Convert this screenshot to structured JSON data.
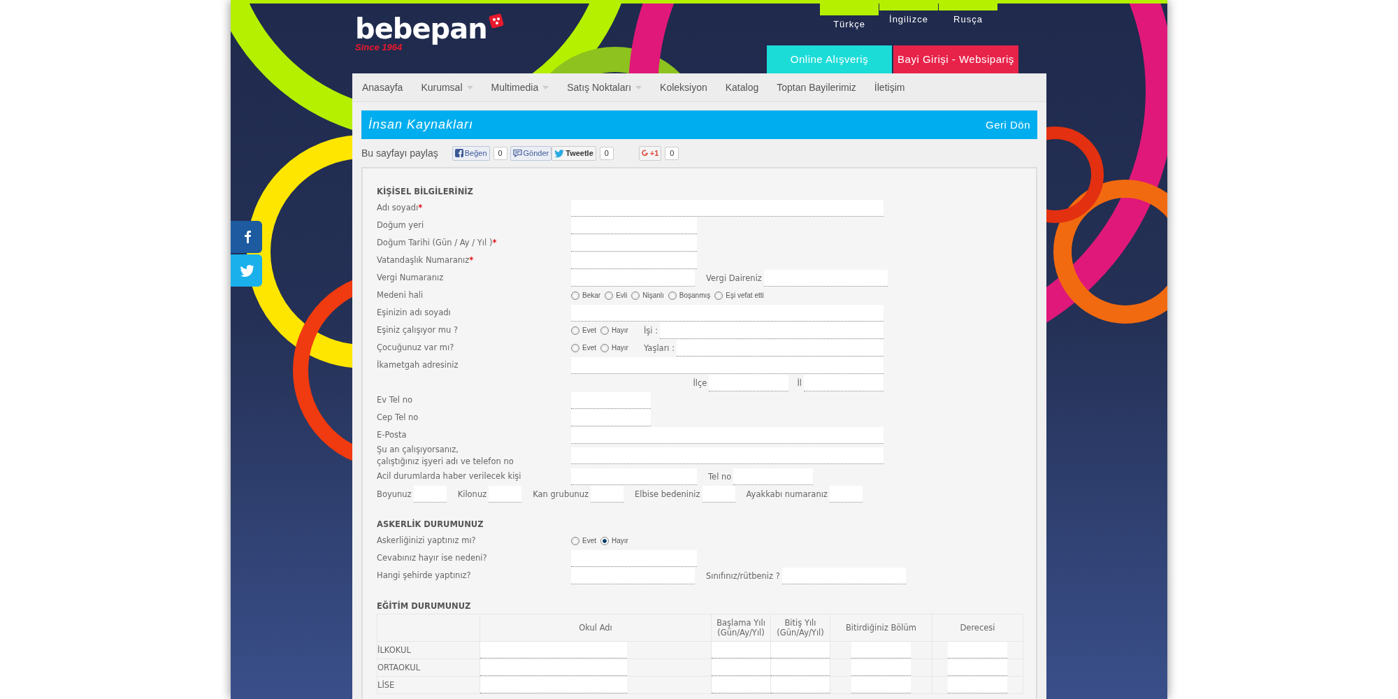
{
  "languages": [
    {
      "label": "Türkçe",
      "selected": true
    },
    {
      "label": "İngilizce",
      "selected": false
    },
    {
      "label": "Rusça",
      "selected": false
    }
  ],
  "logo": {
    "name": "bebepan",
    "tagline": "Since 1964"
  },
  "header_buttons": [
    {
      "label": "Online Alışveriş",
      "color": "#1cdcd8"
    },
    {
      "label": "Bayi Girişi - Websipariş",
      "color": "#e8234a"
    }
  ],
  "nav": [
    {
      "label": "Anasayfa",
      "has_dropdown": false
    },
    {
      "label": "Kurumsal",
      "has_dropdown": true
    },
    {
      "label": "Multimedia",
      "has_dropdown": true
    },
    {
      "label": "Satış Noktaları",
      "has_dropdown": true
    },
    {
      "label": "Koleksiyon",
      "has_dropdown": false
    },
    {
      "label": "Katalog",
      "has_dropdown": false
    },
    {
      "label": "Toptan Bayilerimiz",
      "has_dropdown": false
    },
    {
      "label": "İletişim",
      "has_dropdown": false
    }
  ],
  "social_side": [
    {
      "kind": "facebook"
    },
    {
      "kind": "twitter"
    }
  ],
  "page_title": "İnsan Kaynakları",
  "back_link": "Geri Dön",
  "share": {
    "label": "Bu sayfayı paylaş",
    "buttons": [
      {
        "kind": "facebook",
        "label": "Beğen",
        "count": "0"
      },
      {
        "kind": "comment",
        "label": "Gönder"
      },
      {
        "kind": "twitter",
        "label": "Tweetle",
        "count": "0"
      },
      {
        "kind": "gplus",
        "label": "+1",
        "count": "0"
      }
    ]
  },
  "sections": [
    {
      "heading": "KİŞİSEL BİLGİLERİNİZ",
      "rows": [
        {
          "kind": "standard",
          "label": "Adı soyadı",
          "required_mark": "*",
          "items": [
            {
              "kind": "input-long"
            }
          ]
        },
        {
          "kind": "standard",
          "label": "Doğum yeri",
          "items": [
            {
              "kind": "input-medium"
            }
          ]
        },
        {
          "kind": "standard",
          "label": "Doğum Tarihi (Gün / Ay / Yıl )",
          "required_mark": "*",
          "items": [
            {
              "kind": "input-medium"
            }
          ]
        },
        {
          "kind": "standard",
          "label": "Vatandaşlık Numaranız",
          "required_mark": "*",
          "items": [
            {
              "kind": "input-medium"
            }
          ]
        },
        {
          "kind": "standard",
          "label": "Vergi Numaranız",
          "items": [
            {
              "kind": "input-medium"
            },
            {
              "kind": "label",
              "text": "Vergi Daireniz"
            },
            {
              "kind": "input-medium"
            }
          ]
        },
        {
          "kind": "standard",
          "label": "Medeni hali",
          "items": [
            {
              "kind": "radio",
              "text": "Bekar",
              "selected": false
            },
            {
              "kind": "radio",
              "text": "Evli",
              "selected": false
            },
            {
              "kind": "radio",
              "text": "Nişanlı",
              "selected": false
            },
            {
              "kind": "radio",
              "text": "Boşanmış",
              "selected": false
            },
            {
              "kind": "radio",
              "text": "Eşi vefat etti",
              "selected": false
            }
          ]
        },
        {
          "kind": "standard",
          "label": "Eşinizin adı soyadı",
          "items": [
            {
              "kind": "input-long"
            }
          ]
        },
        {
          "kind": "standard",
          "label": "Eşiniz çalışıyor mu ?",
          "items": [
            {
              "kind": "radio",
              "text": "Evet",
              "selected": false
            },
            {
              "kind": "radio",
              "text": "Hayır",
              "selected": false
            },
            {
              "kind": "label",
              "text": "İşi :"
            },
            {
              "kind": "input-fill"
            }
          ]
        },
        {
          "kind": "standard",
          "label": "Çocuğunuz var mı?",
          "items": [
            {
              "kind": "radio",
              "text": "Evet",
              "selected": false
            },
            {
              "kind": "radio",
              "text": "Hayır",
              "selected": false
            },
            {
              "kind": "label",
              "text": "Yaşları :"
            },
            {
              "kind": "input-fill"
            }
          ]
        },
        {
          "kind": "standard",
          "label": "İkametgah adresiniz",
          "items": [
            {
              "kind": "input-long"
            }
          ]
        },
        {
          "kind": "right",
          "items": [
            {
              "kind": "label",
              "text": "İlçe"
            },
            {
              "kind": "input-short"
            },
            {
              "kind": "label",
              "text": "İl"
            },
            {
              "kind": "input-short"
            }
          ]
        },
        {
          "kind": "standard",
          "label": "Ev Tel no",
          "items": [
            {
              "kind": "input-short"
            }
          ]
        },
        {
          "kind": "standard",
          "label": "Cep Tel no",
          "items": [
            {
              "kind": "input-short"
            }
          ]
        },
        {
          "kind": "standard",
          "label": "E-Posta",
          "items": [
            {
              "kind": "input-long"
            }
          ]
        },
        {
          "kind": "standard",
          "label": "Şu an çalışıyorsanız,\nçalıştığınız işyeri adı ve telefon no",
          "items": [
            {
              "kind": "input-long"
            }
          ]
        },
        {
          "kind": "standard",
          "label": "Acil durumlarda haber verilecek kişi",
          "items": [
            {
              "kind": "input-medium"
            },
            {
              "kind": "label",
              "text": "Tel no"
            },
            {
              "kind": "input-short"
            }
          ]
        },
        {
          "kind": "inline",
          "items": [
            {
              "kind": "label",
              "text": "Boyunuz"
            },
            {
              "kind": "input-mini"
            },
            {
              "kind": "label",
              "text": "Kilonuz"
            },
            {
              "kind": "input-mini"
            },
            {
              "kind": "label",
              "text": "Kan grubunuz"
            },
            {
              "kind": "input-mini"
            },
            {
              "kind": "label",
              "text": "Elbise bedeniniz"
            },
            {
              "kind": "input-mini"
            },
            {
              "kind": "label",
              "text": "Ayakkabı numaranız"
            },
            {
              "kind": "input-mini"
            }
          ]
        }
      ]
    },
    {
      "heading": "ASKERLİK DURUMUNUZ",
      "rows": [
        {
          "kind": "standard",
          "label": "Askerliğinizi yaptınız mı?",
          "items": [
            {
              "kind": "radio",
              "text": "Evet",
              "selected": false
            },
            {
              "kind": "radio",
              "text": "Hayır",
              "selected": true
            }
          ]
        },
        {
          "kind": "standard",
          "label": "Cevabınız hayır ise nedeni?",
          "items": [
            {
              "kind": "input-medium"
            }
          ]
        },
        {
          "kind": "standard",
          "label": "Hangi şehirde yaptınız?",
          "items": [
            {
              "kind": "input-medium"
            },
            {
              "kind": "label",
              "text": "Sınıfınız/rütbeniz ?"
            },
            {
              "kind": "input-medium"
            }
          ]
        }
      ]
    }
  ],
  "education": {
    "heading": "EĞİTİM DURUMUNUZ",
    "columns": [
      "",
      "Okul Adı",
      "Başlama Yılı\n(Gün/Ay/Yıl)",
      "Bitiş Yılı\n(Gün/Ay/Yıl)",
      "Bitirdiğiniz Bölüm",
      "Derecesi"
    ],
    "rows": [
      "İLKOKUL",
      "ORTAOKUL",
      "LİSE"
    ]
  }
}
